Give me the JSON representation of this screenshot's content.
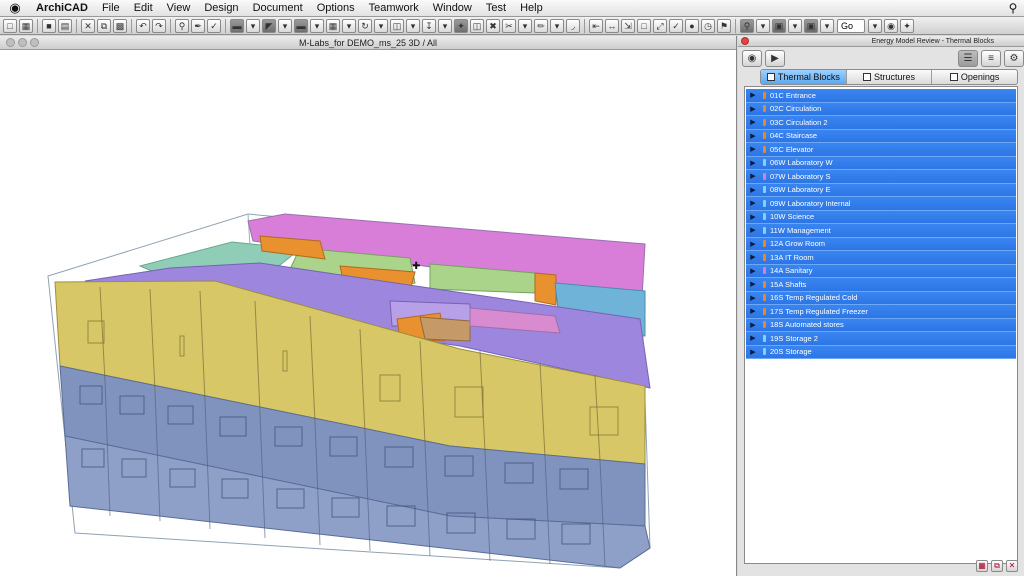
{
  "menubar": {
    "apple": "",
    "items": [
      "ArchiCAD",
      "File",
      "Edit",
      "View",
      "Design",
      "Document",
      "Options",
      "Teamwork",
      "Window",
      "Test",
      "Help"
    ]
  },
  "toolbar": {
    "select_value": "Go"
  },
  "window3d": {
    "title": "M-Labs_for DEMO_ms_25 3D / All"
  },
  "palette": {
    "title": "Energy Model Review - Thermal Blocks",
    "tabs": [
      {
        "label": "Thermal Blocks",
        "active": true
      },
      {
        "label": "Structures",
        "active": false
      },
      {
        "label": "Openings",
        "active": false
      }
    ],
    "rows": [
      {
        "label": "01C Entrance",
        "color": "#e8882a"
      },
      {
        "label": "02C Circulation",
        "color": "#e8882a"
      },
      {
        "label": "03C Circulation 2",
        "color": "#e8882a"
      },
      {
        "label": "04C Staircase",
        "color": "#e8882a"
      },
      {
        "label": "05C Elevator",
        "color": "#e8882a"
      },
      {
        "label": "06W Laboratory W",
        "color": "#7fd3ff"
      },
      {
        "label": "07W Laboratory S",
        "color": "#d27fe0"
      },
      {
        "label": "08W Laboratory E",
        "color": "#7fd3ff"
      },
      {
        "label": "09W Laboratory Internal",
        "color": "#7fd3ff"
      },
      {
        "label": "10W Science",
        "color": "#7fd3ff"
      },
      {
        "label": "11W Management",
        "color": "#7fd3ff"
      },
      {
        "label": "12A Grow Room",
        "color": "#e8882a"
      },
      {
        "label": "13A IT Room",
        "color": "#e8882a"
      },
      {
        "label": "14A Sanitary",
        "color": "#d27fe0"
      },
      {
        "label": "15A Shafts",
        "color": "#e8882a"
      },
      {
        "label": "16S Temp Regulated Cold",
        "color": "#e8882a"
      },
      {
        "label": "17S Temp Regulated Freezer",
        "color": "#e8882a"
      },
      {
        "label": "18S Automated stores",
        "color": "#e8882a"
      },
      {
        "label": "19S Storage 2",
        "color": "#7fd3ff"
      },
      {
        "label": "20S Storage",
        "color": "#7fd3ff"
      }
    ]
  }
}
